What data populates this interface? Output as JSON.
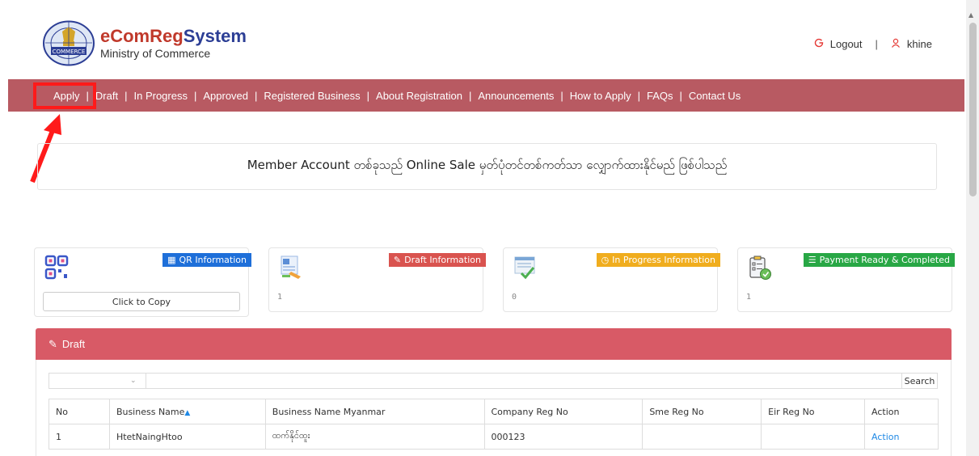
{
  "header": {
    "title_part1": "eComReg",
    "title_part2": "System",
    "subtitle": "Ministry of Commerce",
    "logo_text": "COMMERCE",
    "logout_label": "Logout",
    "separator": "|",
    "username": "khine"
  },
  "nav": {
    "items": [
      "Apply",
      "Draft",
      "In Progress",
      "Approved",
      "Registered Business",
      "About Registration",
      "Announcements",
      "How to Apply",
      "FAQs",
      "Contact Us"
    ],
    "separator": "|"
  },
  "notice": {
    "text": "Member Account တစ်ခုသည် Online Sale မှတ်ပုံတင်တစ်ကတ်သာ လျှောက်ထားနိုင်မည် ဖြစ်ပါသည်"
  },
  "cards": {
    "qr": {
      "badge": "QR Information",
      "button": "Click to Copy",
      "color": "#1e6fd9"
    },
    "draft": {
      "badge": "Draft Information",
      "count": "1",
      "color": "#d9534f"
    },
    "progress": {
      "badge": "In Progress Information",
      "count": "0",
      "color": "#f0ad1e"
    },
    "payment": {
      "badge": "Payment Ready & Completed",
      "count": "1",
      "color": "#28a745"
    }
  },
  "draft_panel": {
    "title": "Draft",
    "search_label": "Search",
    "select_caret": "⌄",
    "columns": [
      "No",
      "Business Name",
      "Business Name Myanmar",
      "Company Reg No",
      "Sme Reg No",
      "Eir Reg No",
      "Action"
    ],
    "rows": [
      {
        "no": "1",
        "business_name": "HtetNaingHtoo",
        "business_name_mm": "ထက်နိုင်ထူး",
        "company_reg_no": "000123",
        "sme_reg_no": "",
        "eir_reg_no": "",
        "action": "Action"
      }
    ]
  }
}
